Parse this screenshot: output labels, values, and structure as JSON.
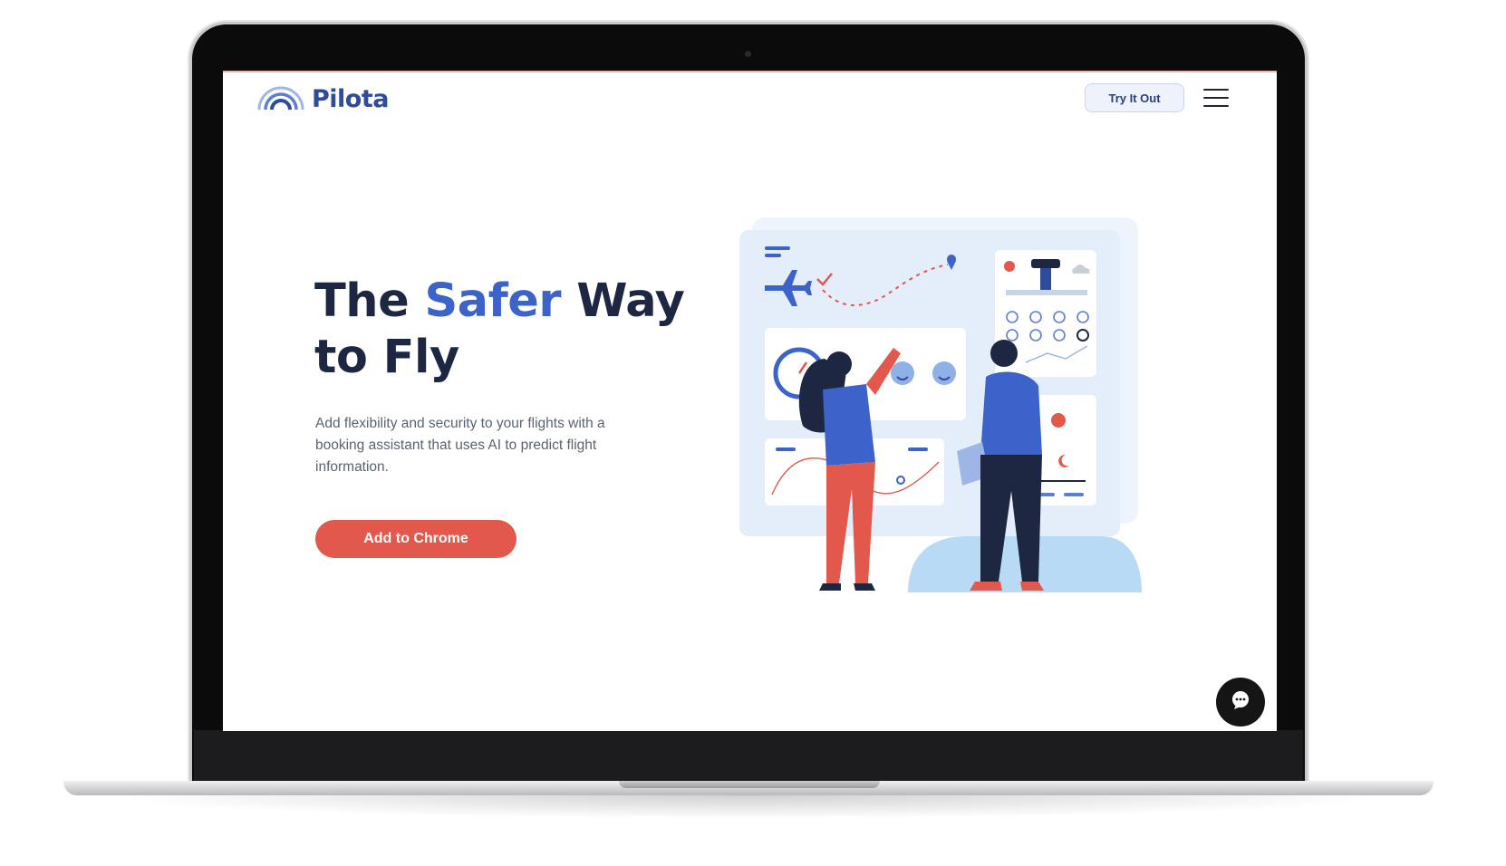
{
  "header": {
    "logo_text": "Pilota",
    "try_label": "Try It Out"
  },
  "hero": {
    "title_part1": "The ",
    "title_accent": "Safer",
    "title_part2": " Way to Fly",
    "description": "Add flexibility and security to your flights with a booking assistant that uses AI to predict flight information.",
    "cta_label": "Add to Chrome"
  },
  "colors": {
    "brand_blue": "#2f4b9b",
    "accent_blue": "#3b63c9",
    "cta_red": "#e2584d",
    "heading_dark": "#1d2741"
  },
  "icons": [
    "rainbow-logo-icon",
    "menu-icon",
    "chat-icon"
  ]
}
